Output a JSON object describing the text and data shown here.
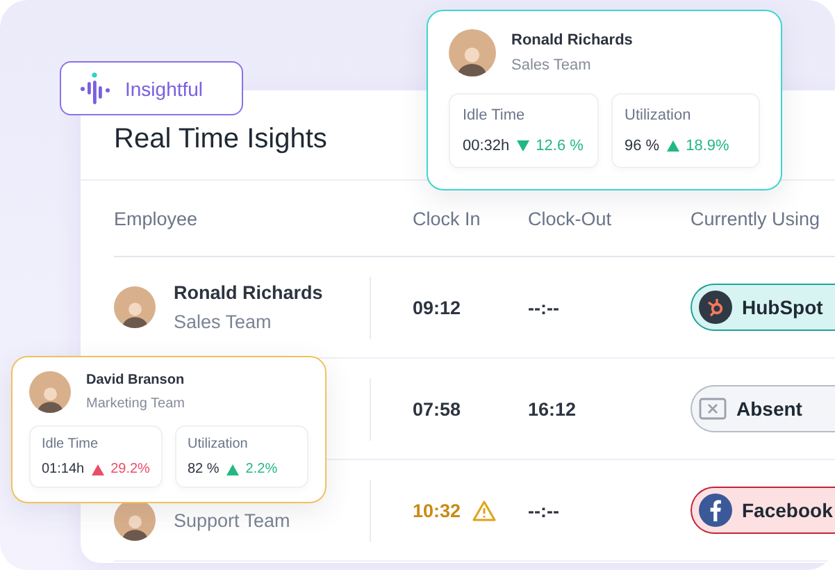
{
  "brand": {
    "name": "Insightful"
  },
  "title": "Real Time Isights",
  "table": {
    "columns": [
      "Employee",
      "Clock In",
      "Clock-Out",
      "Currently Using"
    ],
    "rows": [
      {
        "employee": {
          "name": "Ronald Richards",
          "team": "Sales Team"
        },
        "clock_in": "09:12",
        "late": false,
        "clock_out": "--:--",
        "app": {
          "kind": "hubspot",
          "label": "HubSpot"
        }
      },
      {
        "clock_in": "07:58",
        "late": false,
        "clock_out": "16:12",
        "app": {
          "kind": "absent",
          "label": "Absent"
        }
      },
      {
        "employee": {
          "team": "Support Team"
        },
        "clock_in": "10:32",
        "late": true,
        "clock_out": "--:--",
        "app": {
          "kind": "facebook",
          "label": "Facebook"
        }
      }
    ]
  },
  "popups": [
    {
      "color": "#3dd6d0",
      "name": "Ronald Richards",
      "team": "Sales Team",
      "stats": [
        {
          "label": "Idle Time",
          "value": "00:32h",
          "kind": "down",
          "color": "#22b882",
          "change": "12.6 %"
        },
        {
          "label": "Utilization",
          "value": "96 %",
          "kind": "up",
          "color": "#22b882",
          "change": "18.9%"
        }
      ]
    },
    {
      "color": "#f2c15b",
      "name": "David Branson",
      "team": "Marketing Team",
      "stats": [
        {
          "label": "Idle Time",
          "value": "01:14h",
          "kind": "up",
          "color": "#ea4d68",
          "change": "29.2%"
        },
        {
          "label": "Utilization",
          "value": "82 %",
          "kind": "up",
          "color": "#22b882",
          "change": "2.2%"
        }
      ]
    }
  ]
}
